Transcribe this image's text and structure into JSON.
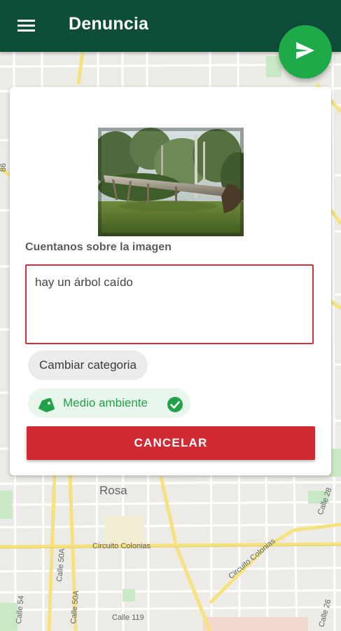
{
  "app_bar": {
    "title": "Denuncia",
    "menu_icon": "hamburger-menu-icon",
    "background_color": "#0f4d3b"
  },
  "send_fab": {
    "icon": "send-icon",
    "color": "#1faa4a"
  },
  "report_form": {
    "image_alt": "árbol caído",
    "section_label": "Cuentanos sobre la imagen",
    "description_value": "hay un árbol caído",
    "change_category_label": "Cambiar categoria",
    "selected_category": {
      "label": "Medio ambiente",
      "icon": "tag-icon",
      "status_icon": "check-circle-icon",
      "color": "#23a14a"
    },
    "cancel_label": "CANCELAR",
    "cancel_color": "#d12a34",
    "error_border_color": "#d0313b"
  },
  "map": {
    "labels": [
      "Rosa",
      "Circuito Colonias",
      "Circuito Colonias",
      "Calle 50A",
      "Calle 50A",
      "Calle 119",
      "Calle 54",
      "Calle 28",
      "Calle 26",
      "86"
    ]
  }
}
